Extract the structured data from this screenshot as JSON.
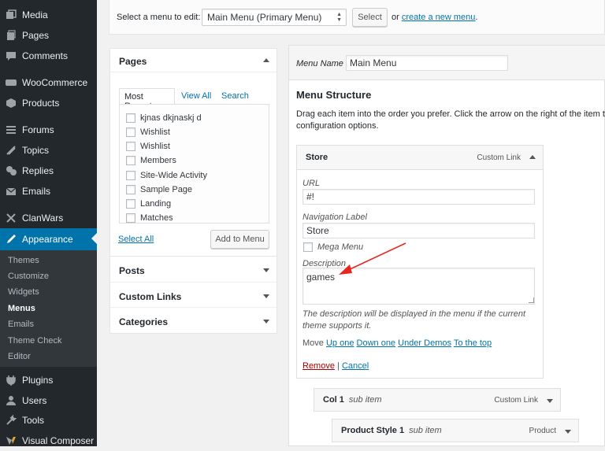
{
  "sidebar": {
    "items": [
      {
        "label": "Media",
        "icon": "media-icon"
      },
      {
        "label": "Pages",
        "icon": "pages-icon"
      },
      {
        "label": "Comments",
        "icon": "comments-icon"
      },
      {
        "label": "WooCommerce",
        "icon": "woocommerce-icon"
      },
      {
        "label": "Products",
        "icon": "products-icon"
      },
      {
        "label": "Forums",
        "icon": "forums-icon"
      },
      {
        "label": "Topics",
        "icon": "topics-icon"
      },
      {
        "label": "Replies",
        "icon": "replies-icon"
      },
      {
        "label": "Emails",
        "icon": "emails-icon"
      },
      {
        "label": "ClanWars",
        "icon": "clanwars-icon"
      },
      {
        "label": "Appearance",
        "icon": "appearance-icon"
      },
      {
        "label": "Plugins",
        "icon": "plugins-icon"
      },
      {
        "label": "Users",
        "icon": "users-icon"
      },
      {
        "label": "Tools",
        "icon": "tools-icon"
      },
      {
        "label": "Visual Composer",
        "icon": "visual-composer-icon"
      }
    ],
    "submenu": [
      "Themes",
      "Customize",
      "Widgets",
      "Menus",
      "Emails",
      "Theme Check",
      "Editor"
    ],
    "accent": "#0073aa"
  },
  "topbar": {
    "select_label": "Select a menu to edit:",
    "selected_menu": "Main Menu (Primary Menu)",
    "select_button": "Select",
    "or_text": "or",
    "create_link": "create a new menu",
    "period": "."
  },
  "pages_box": {
    "title": "Pages",
    "tabs": [
      "Most Recent",
      "View All",
      "Search"
    ],
    "items": [
      "kjnas dkjnaskj d",
      "Wishlist",
      "Wishlist",
      "Members",
      "Site-Wide Activity",
      "Sample Page",
      "Landing",
      "Matches"
    ],
    "select_all": "Select All",
    "add_button": "Add to Menu"
  },
  "collapsed_boxes": [
    "Posts",
    "Custom Links",
    "Categories"
  ],
  "menu": {
    "name_label": "Menu Name",
    "name_value": "Main Menu",
    "structure_title": "Menu Structure",
    "instructions_line1": "Drag each item into the order you prefer. Click the arrow on the right of the item to re",
    "instructions_line2": "configuration options.",
    "store_item": {
      "title": "Store",
      "type": "Custom Link",
      "url_label": "URL",
      "url_value": "#!",
      "nav_label": "Navigation Label",
      "nav_value": "Store",
      "mega_menu_label": "Mega Menu",
      "description_label": "Description",
      "description_value": "games",
      "description_help_line1": "The description will be displayed in the menu if the current",
      "description_help_line2": "theme supports it.",
      "move_label": "Move",
      "move_up": "Up one",
      "move_down": "Down one",
      "move_under": "Under Demos",
      "move_top": "To the top",
      "remove": "Remove",
      "separator": "|",
      "cancel": "Cancel"
    },
    "sub_items": [
      {
        "title": "Col 1",
        "sub": "sub item",
        "type": "Custom Link"
      },
      {
        "title": "Product Style 1",
        "sub": "sub item",
        "type": "Product"
      }
    ]
  },
  "annotation_color": "#e8261d"
}
